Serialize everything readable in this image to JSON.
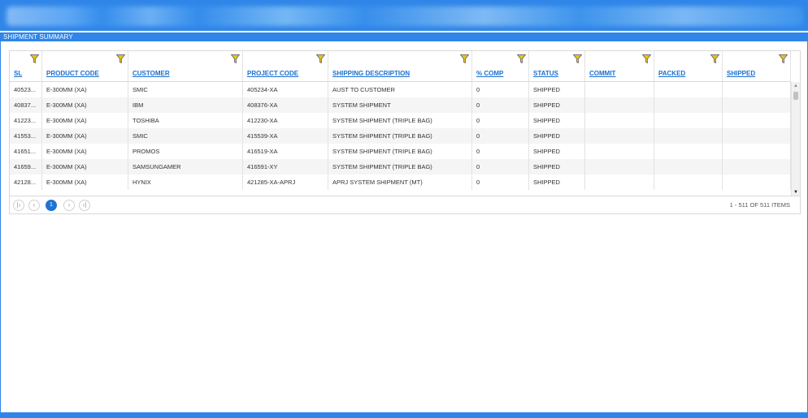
{
  "header": {
    "title": "SHIPMENT SUMMARY"
  },
  "colors": {
    "brand": "#2f86e8",
    "link": "#1a6fd0",
    "filter_icon": "#e8c21c",
    "active_page": "#1f74d4"
  },
  "columns": [
    {
      "label": "SL"
    },
    {
      "label": "PRODUCT CODE"
    },
    {
      "label": "CUSTOMER"
    },
    {
      "label": "PROJECT CODE"
    },
    {
      "label": "SHIPPING DESCRIPTION"
    },
    {
      "label": "% COMP"
    },
    {
      "label": "STATUS"
    },
    {
      "label": "COMMIT"
    },
    {
      "label": "PACKED"
    },
    {
      "label": "SHIPPED"
    }
  ],
  "rows": [
    [
      "40523...",
      "E-300MM (XA)",
      "SMIC",
      "405234-XA",
      "AUST TO CUSTOMER",
      "0",
      "SHIPPED",
      "",
      "",
      ""
    ],
    [
      "40837...",
      "E-300MM (XA)",
      "IBM",
      "408376-XA",
      "SYSTEM SHIPMENT",
      "0",
      "SHIPPED",
      "",
      "",
      ""
    ],
    [
      "41223...",
      "E-300MM (XA)",
      "TOSHIBA",
      "412230-XA",
      "SYSTEM SHIPMENT (TRIPLE BAG)",
      "0",
      "SHIPPED",
      "",
      "",
      ""
    ],
    [
      "41553...",
      "E-300MM (XA)",
      "SMIC",
      "415539-XA",
      "SYSTEM SHIPMENT (TRIPLE BAG)",
      "0",
      "SHIPPED",
      "",
      "",
      ""
    ],
    [
      "41651...",
      "E-300MM (XA)",
      "PROMOS",
      "416519-XA",
      "SYSTEM SHIPMENT (TRIPLE BAG)",
      "0",
      "SHIPPED",
      "",
      "",
      ""
    ],
    [
      "41659...",
      "E-300MM (XA)",
      "SAMSUNGAMER",
      "416591-XY",
      "SYSTEM SHIPMENT (TRIPLE BAG)",
      "0",
      "SHIPPED",
      "",
      "",
      ""
    ],
    [
      "42128...",
      "E-300MM (XA)",
      "HYNIX",
      "421285-XA-APRJ",
      "APRJ SYSTEM SHIPMENT (MT)",
      "0",
      "SHIPPED",
      "",
      "",
      ""
    ]
  ],
  "pager": {
    "first_icon": "first-page-icon",
    "prev_icon": "prev-page-icon",
    "current_page": "1",
    "next_icon": "next-page-icon",
    "last_icon": "last-page-icon",
    "info": "1 - 511 OF 511 ITEMS"
  }
}
